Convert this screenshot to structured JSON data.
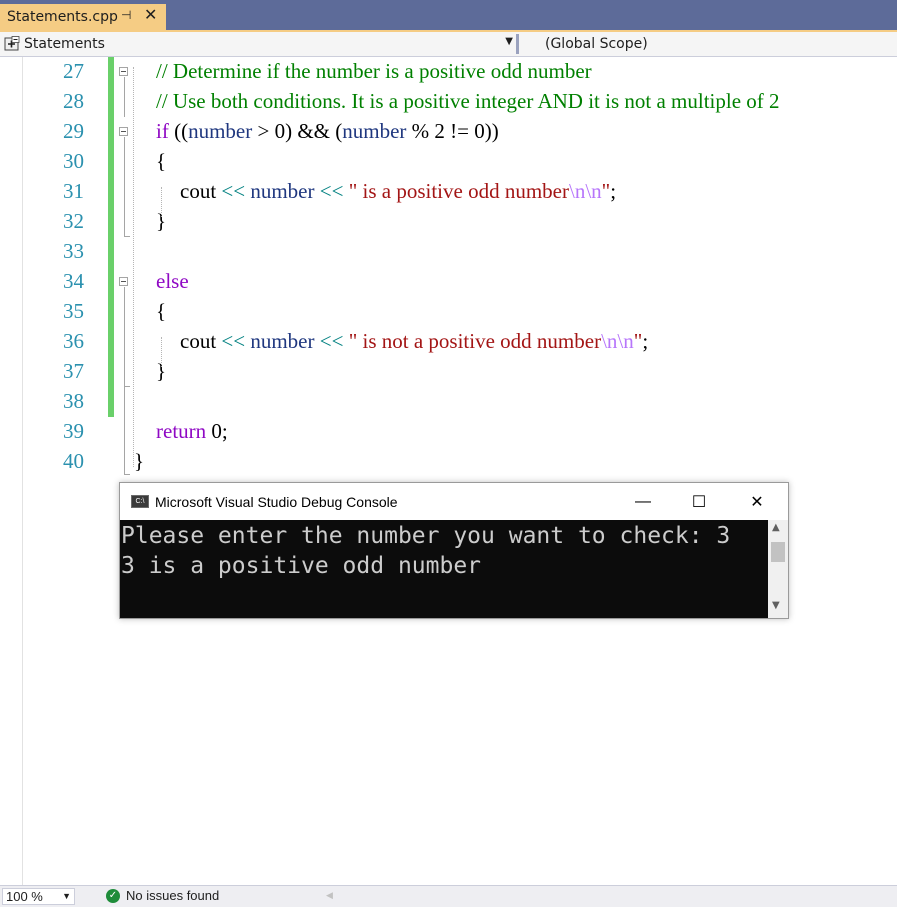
{
  "tab": {
    "title": "Statements.cpp",
    "pin_glyph": "⊣",
    "close_glyph": "✕"
  },
  "navbar": {
    "scope_left": "Statements",
    "scope_right": "(Global Scope)"
  },
  "editor": {
    "lines": [
      {
        "num": "27",
        "tokens": [
          {
            "t": "// Determine if the number is a positive odd number",
            "c": "c-comment"
          }
        ]
      },
      {
        "num": "28",
        "tokens": [
          {
            "t": "// Use both conditions. It is a positive integer AND it is not a multiple of 2",
            "c": "c-comment"
          }
        ]
      },
      {
        "num": "29",
        "tokens": [
          {
            "t": "if",
            "c": "c-kw"
          },
          {
            "t": " ((",
            "c": "c-plain"
          },
          {
            "t": "number",
            "c": "c-id"
          },
          {
            "t": " > 0) && (",
            "c": "c-plain"
          },
          {
            "t": "number",
            "c": "c-id"
          },
          {
            "t": " % 2 != 0))",
            "c": "c-plain"
          }
        ]
      },
      {
        "num": "30",
        "tokens": [
          {
            "t": "{",
            "c": "c-plain"
          }
        ]
      },
      {
        "num": "31",
        "tokens": [
          {
            "t": "cout",
            "c": "c-plain"
          },
          {
            "t": " << ",
            "c": "c-op"
          },
          {
            "t": "number",
            "c": "c-id"
          },
          {
            "t": " << ",
            "c": "c-op"
          },
          {
            "t": "\" is a positive odd number",
            "c": "c-str"
          },
          {
            "t": "\\n\\n",
            "c": "c-esc"
          },
          {
            "t": "\"",
            "c": "c-str"
          },
          {
            "t": ";",
            "c": "c-plain"
          }
        ]
      },
      {
        "num": "32",
        "tokens": [
          {
            "t": "}",
            "c": "c-plain"
          }
        ]
      },
      {
        "num": "33",
        "tokens": []
      },
      {
        "num": "34",
        "tokens": [
          {
            "t": "else",
            "c": "c-kw"
          }
        ]
      },
      {
        "num": "35",
        "tokens": [
          {
            "t": "{",
            "c": "c-plain"
          }
        ]
      },
      {
        "num": "36",
        "tokens": [
          {
            "t": "cout",
            "c": "c-plain"
          },
          {
            "t": " << ",
            "c": "c-op"
          },
          {
            "t": "number",
            "c": "c-id"
          },
          {
            "t": " << ",
            "c": "c-op"
          },
          {
            "t": "\" is not a positive odd number",
            "c": "c-str"
          },
          {
            "t": "\\n\\n",
            "c": "c-esc"
          },
          {
            "t": "\"",
            "c": "c-str"
          },
          {
            "t": ";",
            "c": "c-plain"
          }
        ]
      },
      {
        "num": "37",
        "tokens": [
          {
            "t": "}",
            "c": "c-plain"
          }
        ]
      },
      {
        "num": "38",
        "tokens": []
      },
      {
        "num": "39",
        "tokens": [
          {
            "t": "return",
            "c": "c-kw"
          },
          {
            "t": " 0;",
            "c": "c-plain"
          }
        ]
      },
      {
        "num": "40",
        "tokens": [
          {
            "t": "}",
            "c": "c-plain"
          }
        ]
      }
    ]
  },
  "console": {
    "title": "Microsoft Visual Studio Debug Console",
    "icon_text": "C:\\",
    "minimize": "—",
    "maximize": "☐",
    "close": "✕",
    "lines": [
      "Please enter the number you want to check: 3",
      "3 is a positive odd number"
    ]
  },
  "status": {
    "zoom": "100 %",
    "issues": "No issues found"
  },
  "colors": {
    "comment": "#008000",
    "keyword": "#8f08c4",
    "identifier": "#1f377f",
    "operator": "#008080",
    "string": "#a31515",
    "escape": "#b776fb",
    "line_number": "#2b91af",
    "change_bar": "#6ad06a",
    "tab_active": "#f5cc84",
    "tab_strip": "#5d6b99"
  }
}
